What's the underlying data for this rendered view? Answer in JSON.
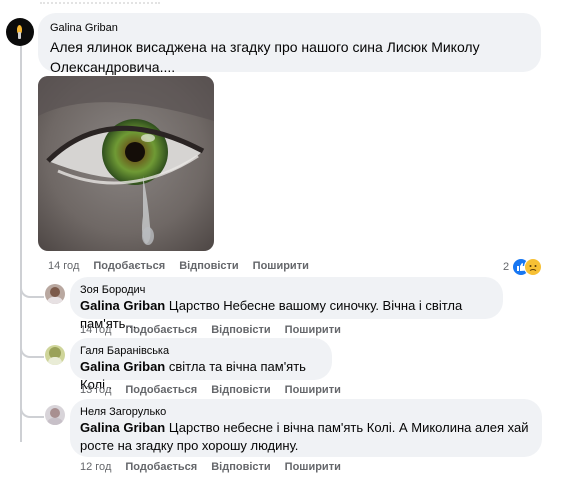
{
  "post_comment": {
    "author": "Galina Griban",
    "text": "Алея ялинок висаджена на згадку про нашого сина Лисюк Миколу Олександровича....",
    "image_icon": "crying-eye-photo",
    "time": "14 год",
    "like_label": "Подобається",
    "reply_label": "Відповісти",
    "share_label": "Поширити",
    "reaction_count": "2",
    "reaction_icons": [
      "like-icon",
      "sad-icon"
    ]
  },
  "replies": [
    {
      "author": "Зоя Бородич",
      "mention": "Galina Griban",
      "text": " Царство Небесне вашому синочку. Вічна і світла пам'ять...",
      "time": "14 год",
      "like_label": "Подобається",
      "reply_label": "Відповісти",
      "share_label": "Поширити"
    },
    {
      "author": "Галя Баранівська",
      "mention": "Galina Griban",
      "text": " світла та вічна пам'ять Колі .",
      "time": "13 год",
      "like_label": "Подобається",
      "reply_label": "Відповісти",
      "share_label": "Поширити"
    },
    {
      "author": "Неля Загорулько",
      "mention": "Galina Griban",
      "text": " Царство небесне і вічна пам'ять Колі. А Миколина алея хай росте на згадку про хорошу людину.",
      "time": "12 год",
      "like_label": "Подобається",
      "reply_label": "Відповісти",
      "share_label": "Поширити"
    }
  ],
  "colors": {
    "bubble": "#f0f2f5",
    "meta_text": "#65676b",
    "like_blue": "#1877f2",
    "sad_yellow": "#f7c034"
  }
}
